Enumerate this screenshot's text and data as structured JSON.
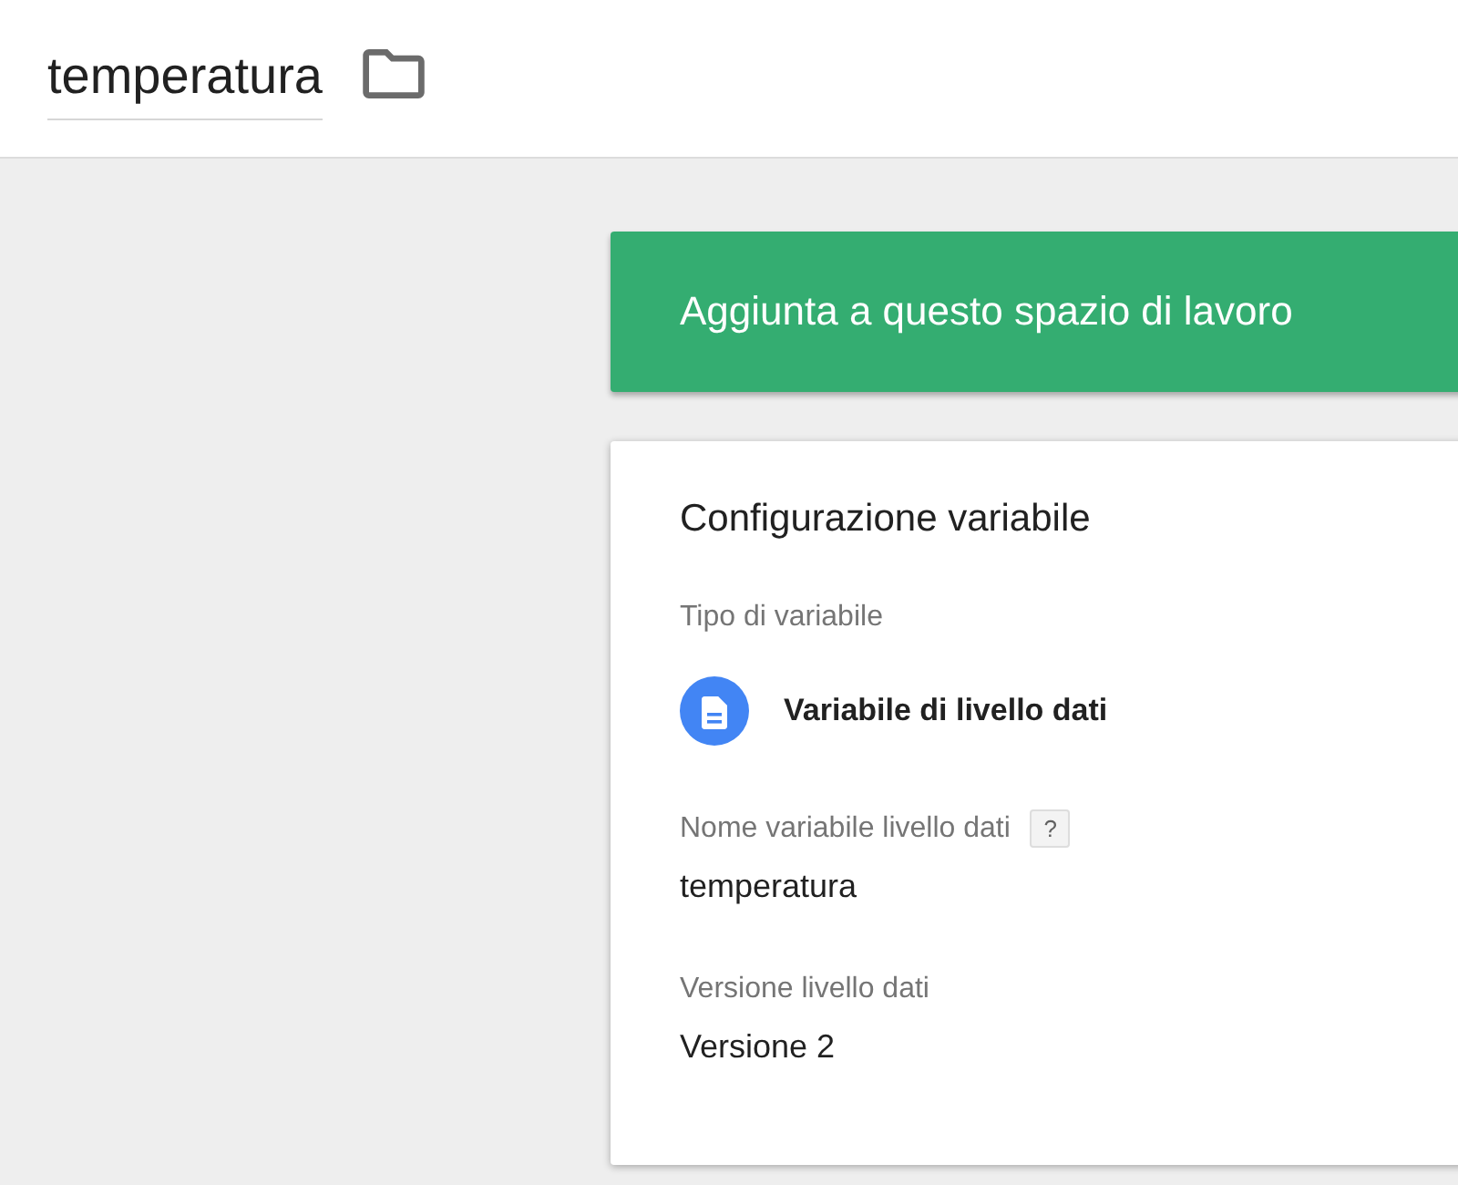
{
  "header": {
    "title": "temperatura"
  },
  "banner": {
    "text": "Aggiunta a questo spazio di lavoro"
  },
  "card": {
    "title": "Configurazione variabile",
    "fields": [
      {
        "kind": "type",
        "label": "Tipo di variabile",
        "value": "Variabile di livello dati"
      },
      {
        "kind": "text",
        "label": "Nome variabile livello dati",
        "help": "?",
        "value": "temperatura"
      },
      {
        "kind": "text",
        "label": "Versione livello dati",
        "value": "Versione 2"
      }
    ]
  }
}
